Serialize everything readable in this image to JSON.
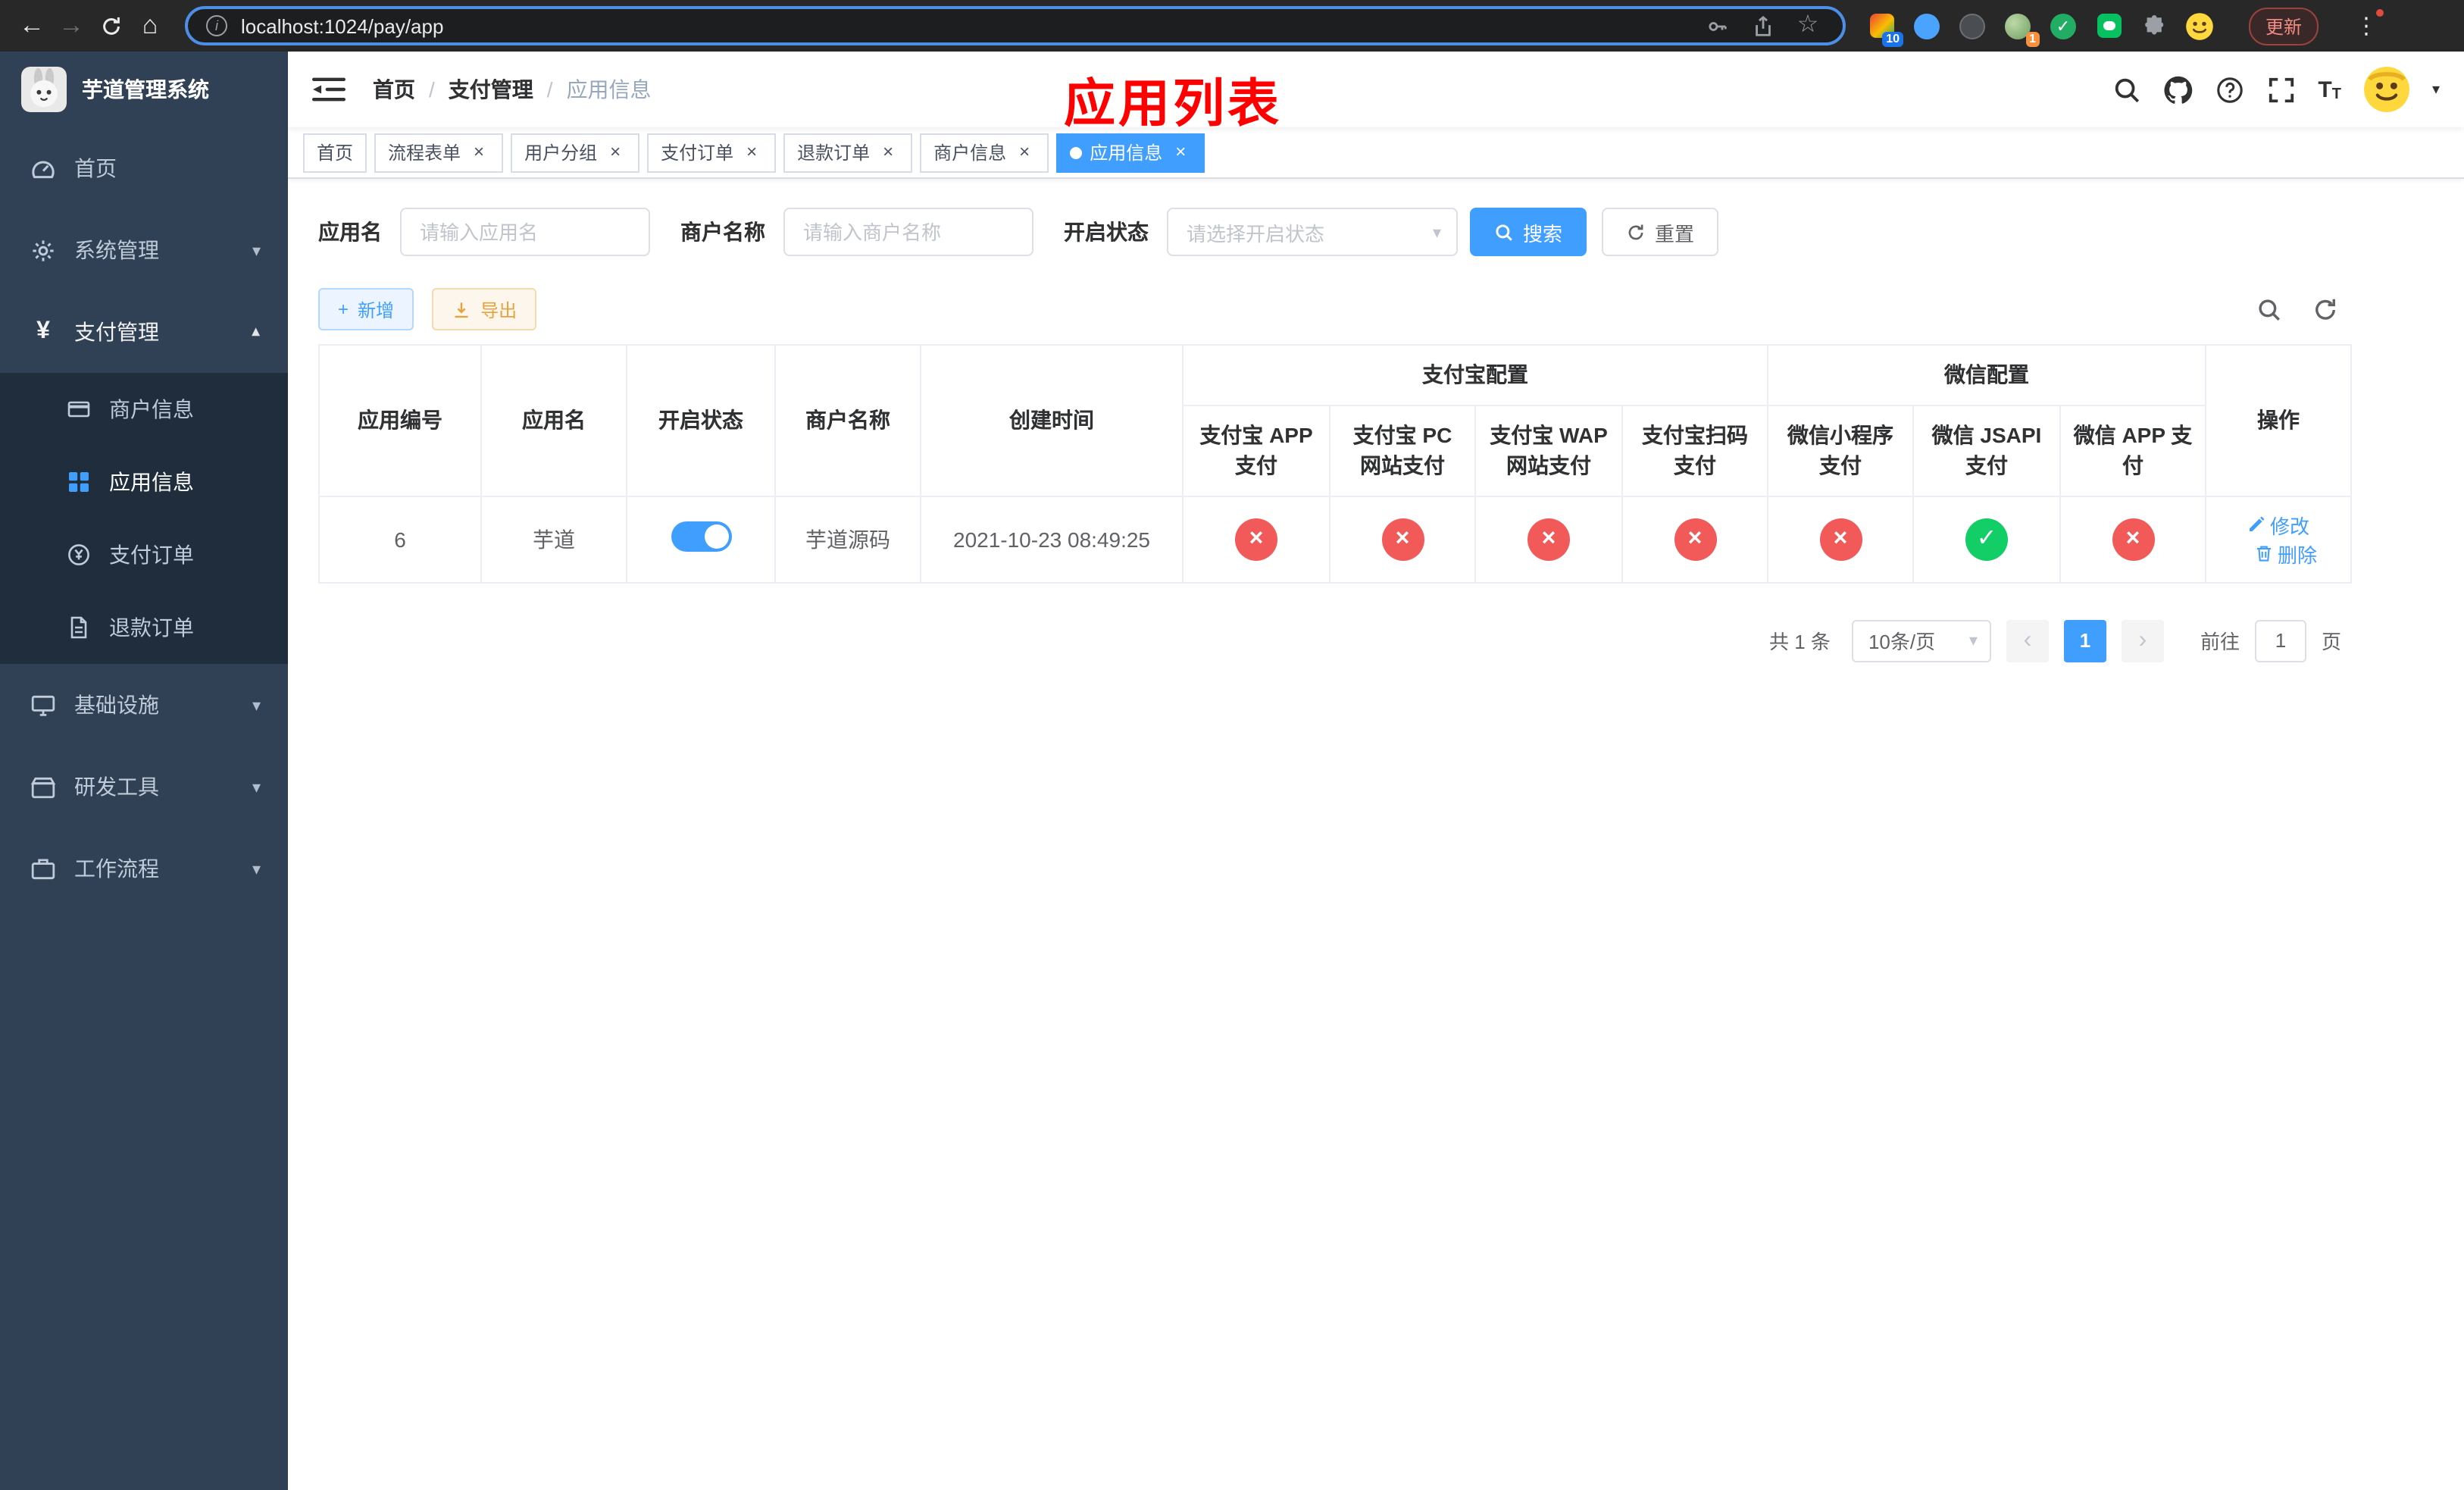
{
  "browser": {
    "url": "localhost:1024/pay/app",
    "update_label": "更新",
    "ext_badge_10": "10",
    "ext_badge_1": "1"
  },
  "icons": {
    "back": "←",
    "forward": "→",
    "home": "⌂",
    "info": "i",
    "star": "☆",
    "menu_dots": "⋮",
    "check": "✓",
    "cross": "×",
    "close": "×",
    "caret_down": "▾",
    "plus": "+",
    "slash": "/",
    "dot": "●",
    "prev": "‹",
    "next": "›",
    "yen": "¥",
    "size_big": "T",
    "size_small": "T"
  },
  "sidebar": {
    "title": "芋道管理系统",
    "items": [
      {
        "label": "首页"
      },
      {
        "label": "系统管理",
        "expandable": true
      },
      {
        "label": "支付管理",
        "expandable": true,
        "expanded": true
      },
      {
        "label": "基础设施",
        "expandable": true
      },
      {
        "label": "研发工具",
        "expandable": true
      },
      {
        "label": "工作流程",
        "expandable": true
      }
    ],
    "pay_children": [
      {
        "label": "商户信息"
      },
      {
        "label": "应用信息",
        "active": true
      },
      {
        "label": "支付订单"
      },
      {
        "label": "退款订单"
      }
    ]
  },
  "header": {
    "breadcrumb": [
      "首页",
      "支付管理",
      "应用信息"
    ],
    "annotation": "应用列表"
  },
  "tabs": [
    {
      "label": "首页",
      "closable": false,
      "active": false
    },
    {
      "label": "流程表单",
      "closable": true,
      "active": false
    },
    {
      "label": "用户分组",
      "closable": true,
      "active": false
    },
    {
      "label": "支付订单",
      "closable": true,
      "active": false
    },
    {
      "label": "退款订单",
      "closable": true,
      "active": false
    },
    {
      "label": "商户信息",
      "closable": true,
      "active": false
    },
    {
      "label": "应用信息",
      "closable": true,
      "active": true
    }
  ],
  "filters": {
    "app_name_label": "应用名",
    "app_name_placeholder": "请输入应用名",
    "merchant_label": "商户名称",
    "merchant_placeholder": "请输入商户名称",
    "status_label": "开启状态",
    "status_placeholder": "请选择开启状态",
    "search_button": "搜索",
    "reset_button": "重置"
  },
  "toolbar": {
    "add_button": "新增",
    "export_button": "导出"
  },
  "table": {
    "columns": {
      "id": "应用编号",
      "name": "应用名",
      "status": "开启状态",
      "merchant": "商户名称",
      "created": "创建时间",
      "alipay_group": "支付宝配置",
      "wechat_group": "微信配置",
      "alipay": [
        "支付宝 APP 支付",
        "支付宝 PC 网站支付",
        "支付宝 WAP 网站支付",
        "支付宝扫码支付"
      ],
      "wechat": [
        "微信小程序支付",
        "微信 JSAPI 支付",
        "微信 APP 支付"
      ],
      "actions": "操作"
    },
    "rows": [
      {
        "id": "6",
        "name": "芋道",
        "enabled": true,
        "merchant": "芋道源码",
        "created_at": "2021-10-23 08:49:25",
        "channels": [
          "no",
          "no",
          "no",
          "no",
          "no",
          "yes",
          "no"
        ],
        "actions": [
          "修改",
          "删除"
        ]
      }
    ]
  },
  "pagination": {
    "total_text": "共 1 条",
    "page_size": "10条/页",
    "current_page": "1",
    "goto_prefix": "前往",
    "goto_value": "1",
    "goto_suffix": "页"
  },
  "colors": {
    "accent": "#409eff",
    "danger": "#f25a5a",
    "success": "#13ce66",
    "warning": "#e6a23c",
    "annotation": "#fe0000",
    "sidebar_bg": "#304156",
    "submenu_bg": "#1f2d3d"
  }
}
